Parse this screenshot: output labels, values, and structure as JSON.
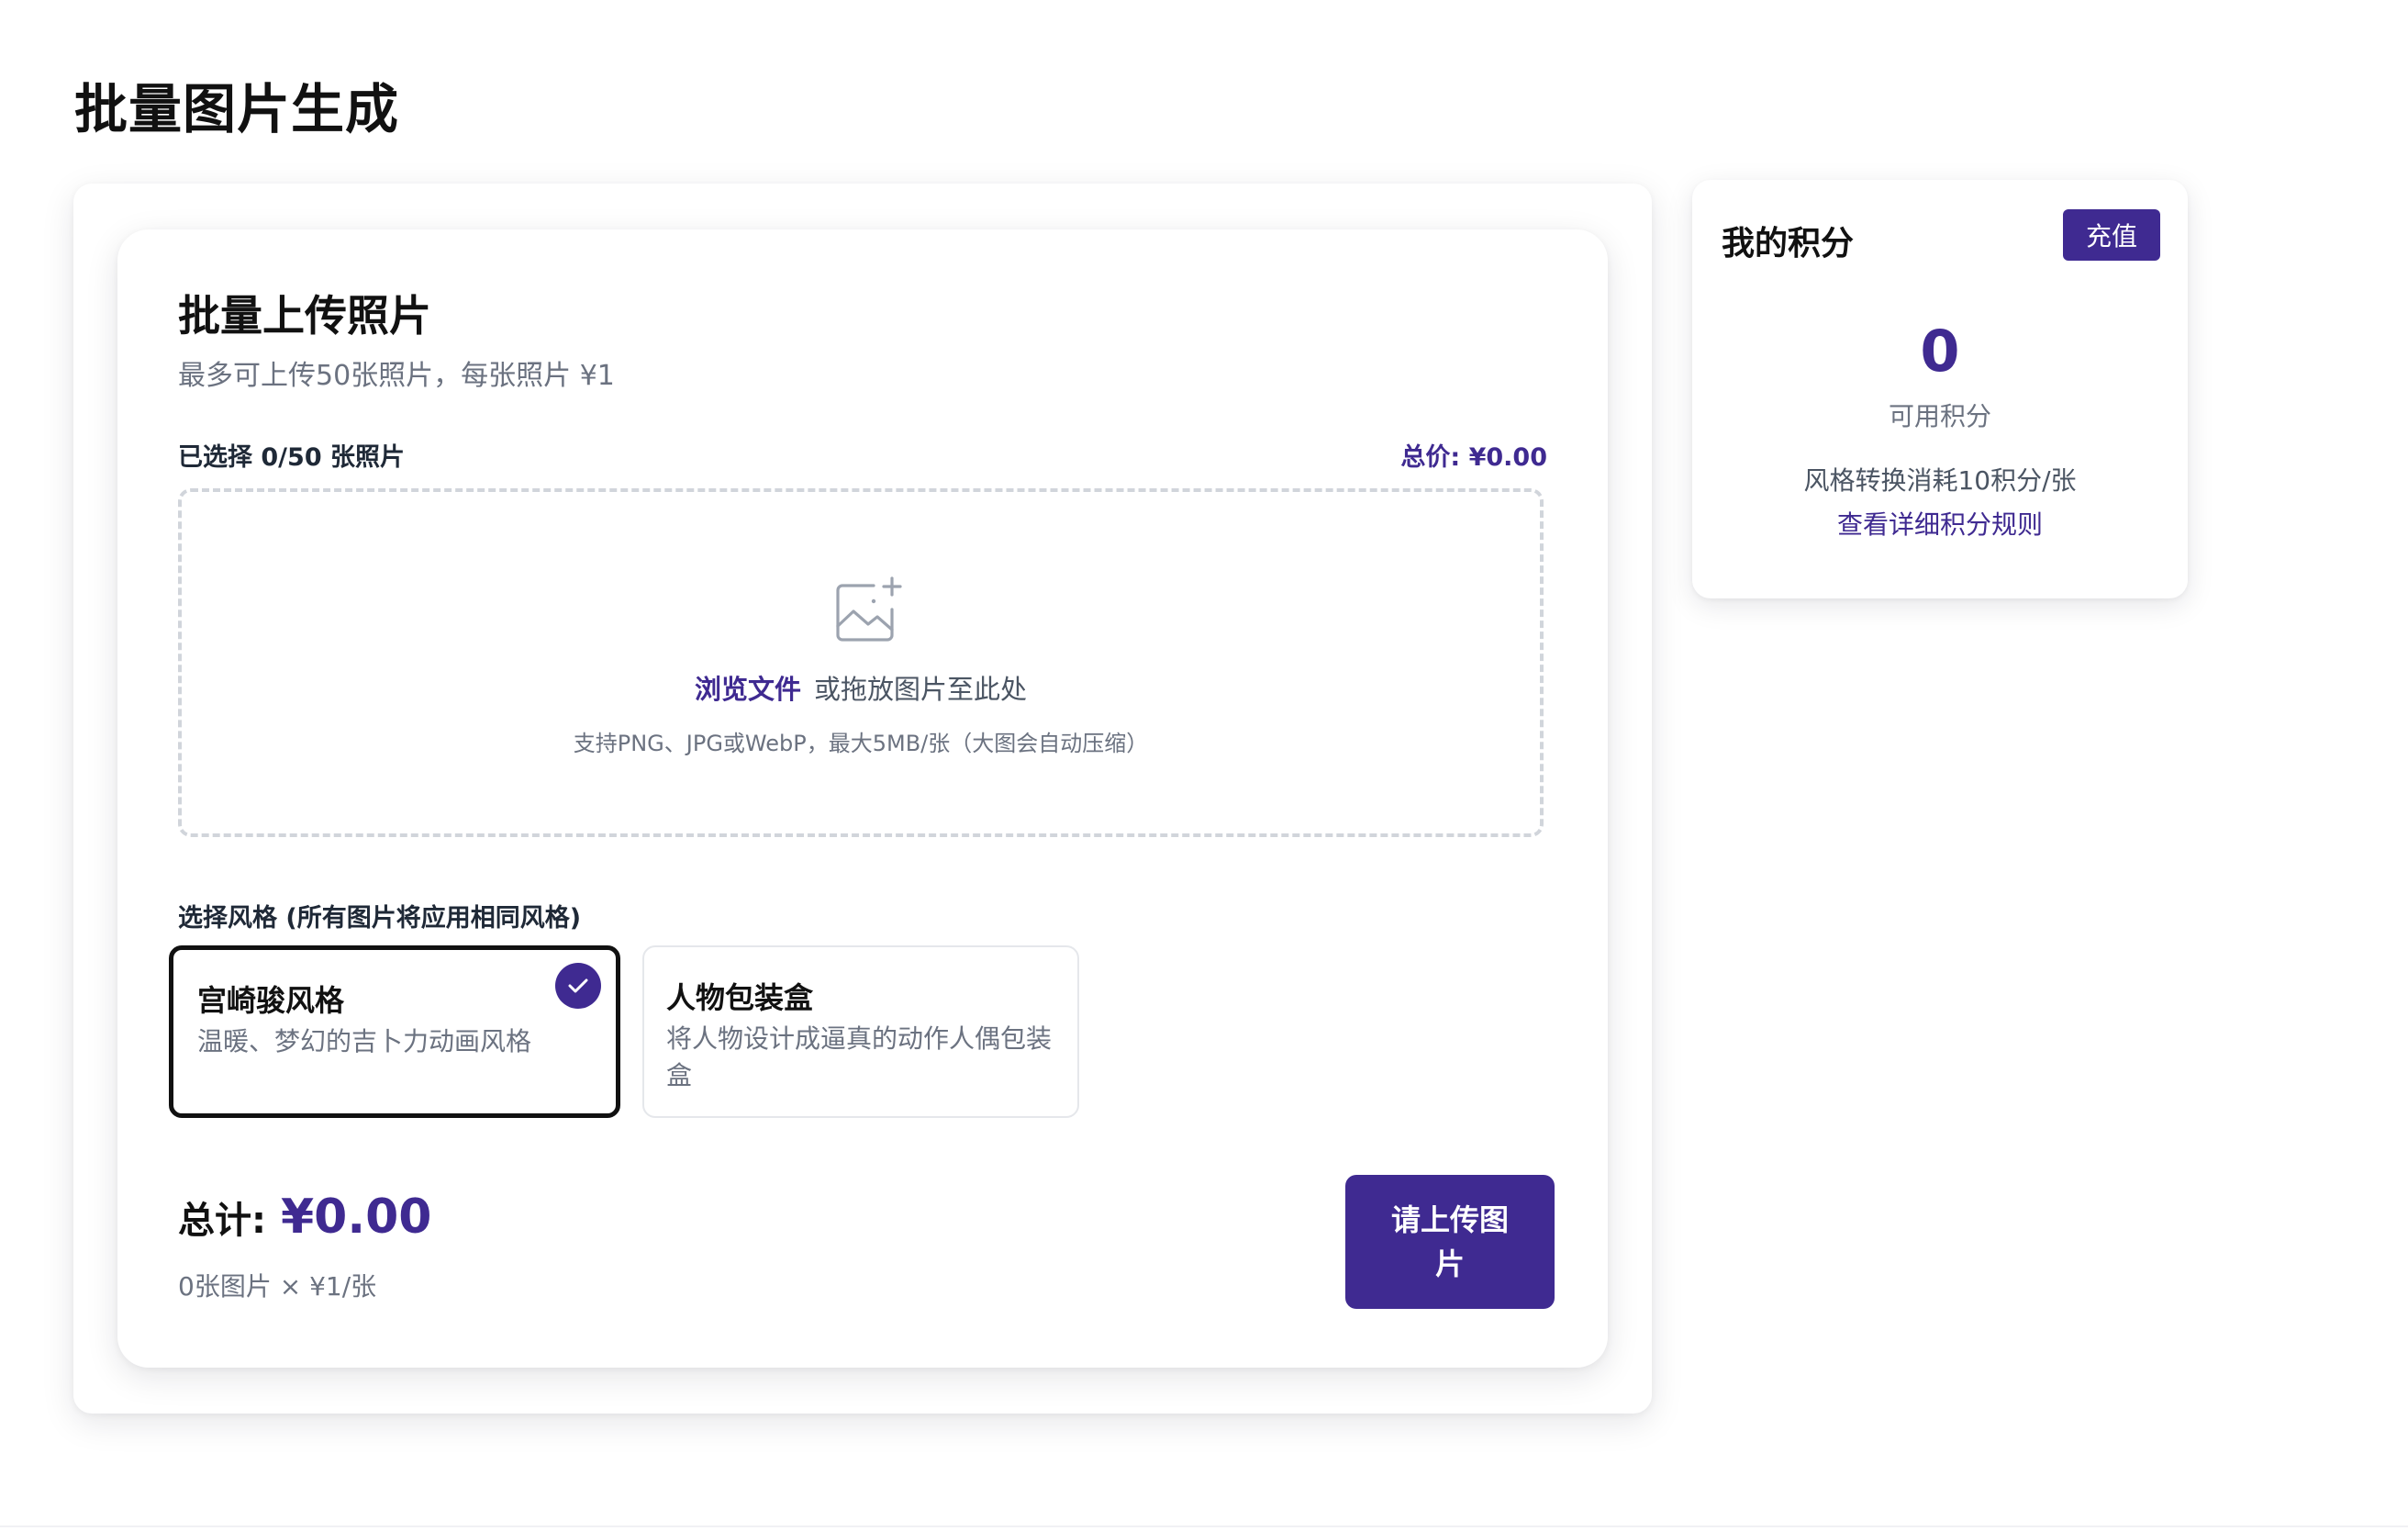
{
  "page": {
    "title": "批量图片生成"
  },
  "colors": {
    "accent": "#3f2a91",
    "muted_text": "#6b7280",
    "dropzone_border": "#d1d5db"
  },
  "upload": {
    "title": "批量上传照片",
    "subtitle": "最多可上传50张照片，每张照片 ¥1",
    "selected_count": "已选择 0/50 张照片",
    "total_price": "总价: ¥0.00",
    "dropzone": {
      "icon": "image-add-icon",
      "browse_label": "浏览文件",
      "drop_text": "或拖放图片至此处",
      "hint": "支持PNG、JPG或WebP，最大5MB/张（大图会自动压缩）"
    },
    "style_section": {
      "label": "选择风格 (所有图片将应用相同风格)",
      "options": [
        {
          "name": "宫崎骏风格",
          "description": "温暖、梦幻的吉卜力动画风格",
          "selected": true
        },
        {
          "name": "人物包装盒",
          "description": "将人物设计成逼真的动作人偶包装盒",
          "selected": false
        }
      ]
    },
    "summary": {
      "total_label": "总计:",
      "total_value": "¥0.00",
      "formula": "0张图片 × ¥1/张"
    },
    "submit_label": "请上传图片"
  },
  "points": {
    "title": "我的积分",
    "recharge_label": "充值",
    "value": "0",
    "caption": "可用积分",
    "rule": "风格转换消耗10积分/张",
    "rules_link": "查看详细积分规则"
  }
}
